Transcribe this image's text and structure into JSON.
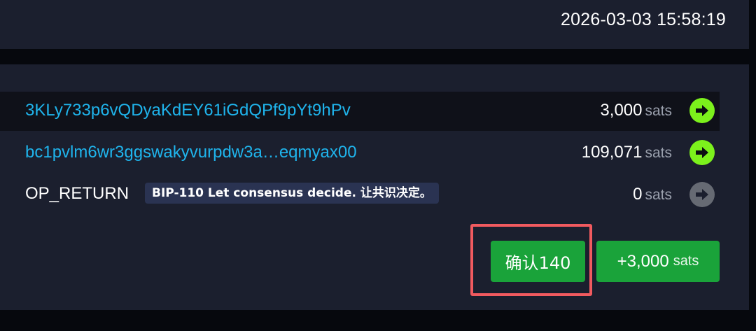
{
  "header": {
    "timestamp": "2026-03-03 15:58:19"
  },
  "outputs": [
    {
      "address": "3KLy733p6vQDyaKdEY61iGdQPf9pYt9hPv",
      "amount": "3,000",
      "unit": "sats",
      "icon": "arrow-right-circle-icon",
      "icon_color": "#7cf11c"
    },
    {
      "address": "bc1pvlm6wr3ggswakyvurpdw3a…eqmyax00",
      "amount": "109,071",
      "unit": "sats",
      "icon": "arrow-right-circle-icon",
      "icon_color": "#7cf11c"
    },
    {
      "label": "OP_RETURN",
      "message": "BIP-110 Let consensus decide. 让共识决定。",
      "amount": "0",
      "unit": "sats",
      "icon": "arrow-right-circle-icon",
      "icon_color": "#666a73"
    }
  ],
  "footer": {
    "confirmations_label": "确认140",
    "total_value": "+3,000",
    "total_unit": "sats"
  },
  "colors": {
    "address": "#1fb4ec",
    "button": "#1aa33a",
    "highlight_border": "#f15a5f",
    "panel": "#1b1f2e"
  }
}
